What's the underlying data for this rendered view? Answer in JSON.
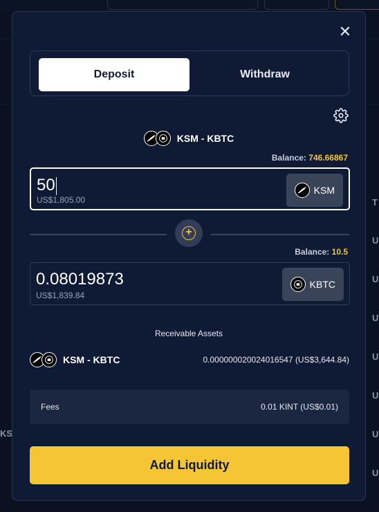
{
  "modal": {
    "close_label": "✕",
    "tabs": [
      {
        "label": "Deposit",
        "active": true
      },
      {
        "label": "Withdraw",
        "active": false
      }
    ],
    "settings_icon": "gear-icon",
    "pair_title": "KSM - KBTC",
    "input_a": {
      "balance_label": "Balance:",
      "balance_value": "746.66867",
      "value": "50",
      "usd": "US$1,805.00",
      "token": "KSM"
    },
    "input_b": {
      "balance_label": "Balance:",
      "balance_value": "10.5",
      "value": "0.08019873",
      "usd": "US$1,839.84",
      "token": "KBTC"
    },
    "receivable": {
      "title": "Receivable Assets",
      "pair": "KSM - KBTC",
      "amount": "0.000000020024016547 (US$3,644.84)"
    },
    "fees": {
      "label": "Fees",
      "value": "0.01 KINT (US$0.01)"
    },
    "submit_label": "Add Liquidity"
  },
  "background": {
    "right_letters": [
      "T",
      "U",
      "U",
      "U",
      "U",
      "U",
      "U",
      "U"
    ],
    "left_text": "KS"
  },
  "colors": {
    "accent": "#f5c535",
    "modal_bg": "#0f1a35",
    "page_bg": "#0a1222",
    "field_bg": "#3a4459"
  }
}
